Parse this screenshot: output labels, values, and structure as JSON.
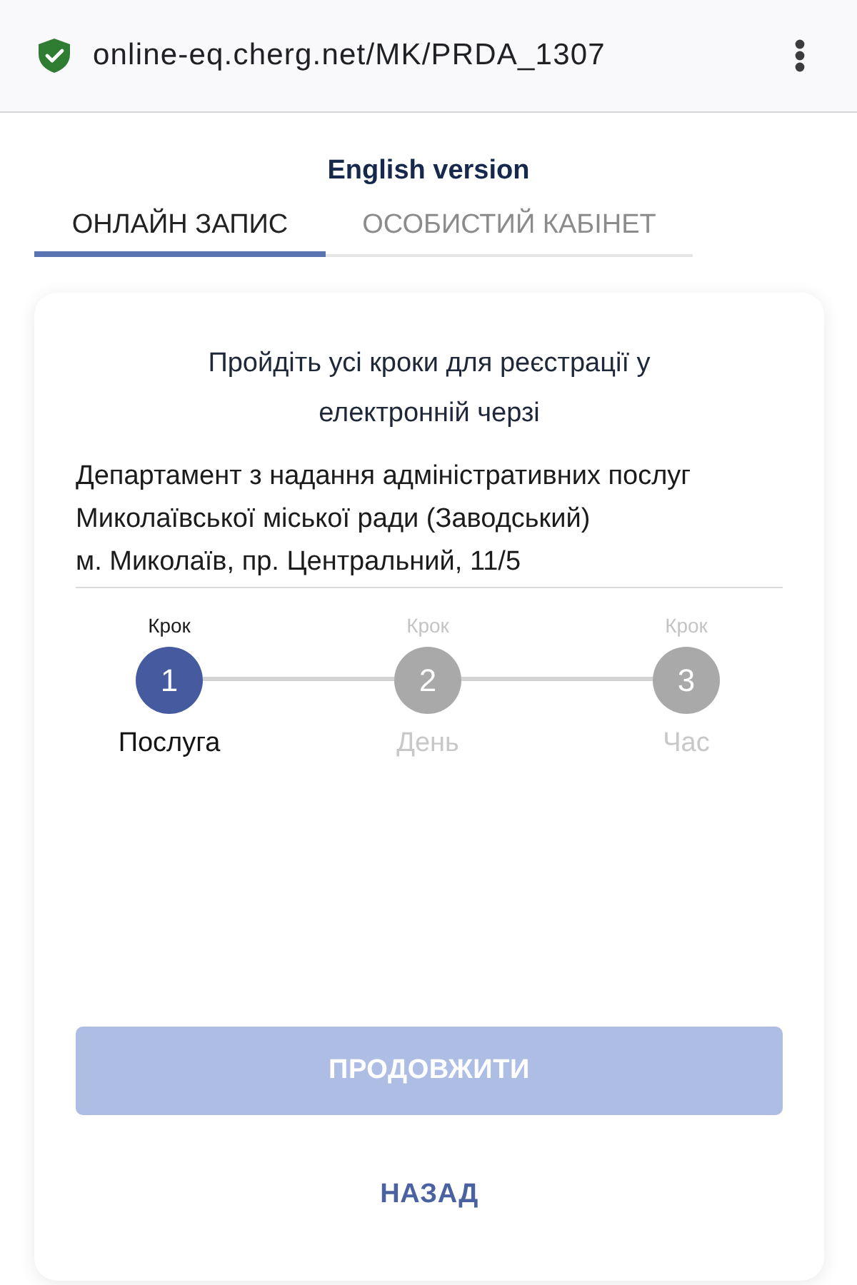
{
  "browser": {
    "secure": true,
    "url": "online-eq.cherg.net/MK/PRDA_1307"
  },
  "language_link": "English version",
  "tabs": [
    {
      "label": "ОНЛАЙН ЗАПИС",
      "selected": true
    },
    {
      "label": "ОСОБИСТИЙ КАБІНЕТ",
      "selected": false
    }
  ],
  "card": {
    "heading": "Пройдіть усі кроки для реєстрації у електронній черзі",
    "department": "Департамент з надання адміністративних послуг Миколаївської міської ради (Заводський)",
    "address": "м. Миколаїв, пр. Центральний, 11/5",
    "steps": [
      {
        "caption": "Крок",
        "number": "1",
        "label": "Послуга",
        "selected": true
      },
      {
        "caption": "Крок",
        "number": "2",
        "label": "День",
        "selected": false
      },
      {
        "caption": "Крок",
        "number": "3",
        "label": "Час",
        "selected": false
      }
    ],
    "continue_button": {
      "label": "ПРОДОВЖИТИ",
      "disabled": true
    },
    "back_button": {
      "label": "НАЗАД"
    }
  }
}
